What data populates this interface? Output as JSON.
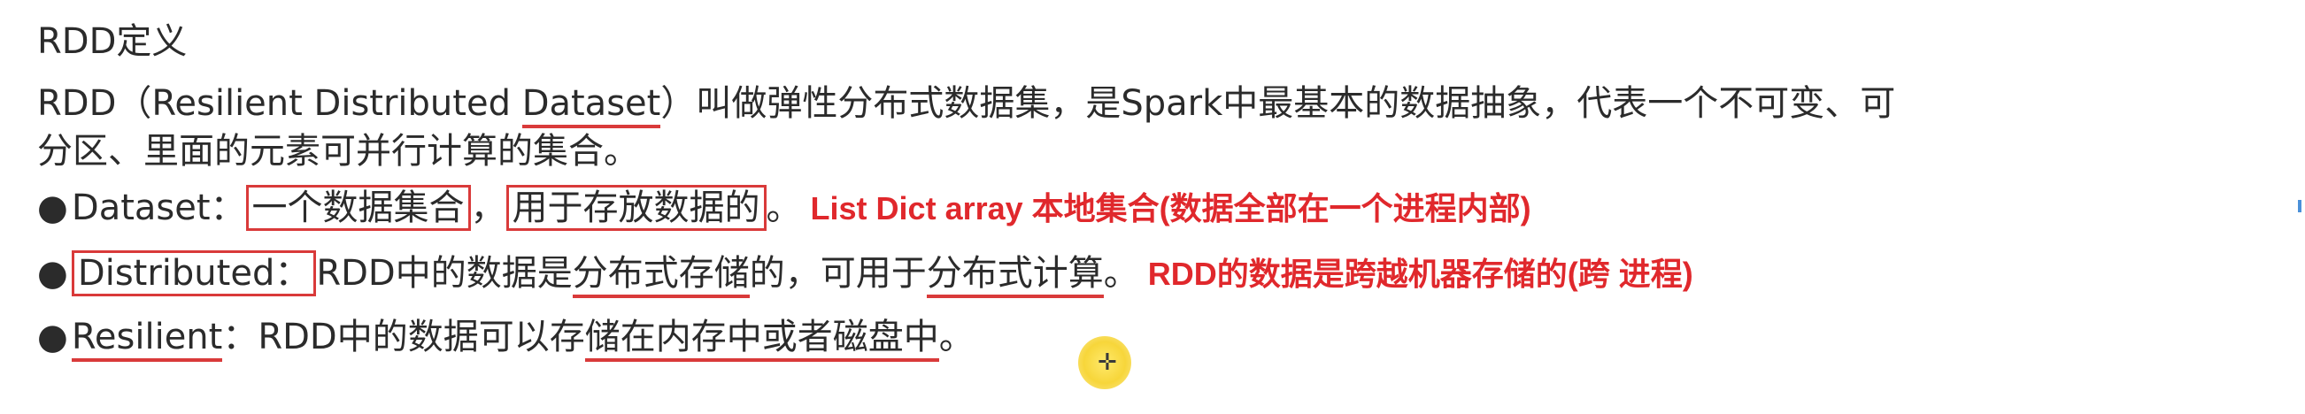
{
  "title": "RDD定义",
  "intro": {
    "line1_a": "RDD（Resilient Distributed ",
    "line1_underlined": "Dataset",
    "line1_b": "）叫做弹性分布式数据集，是Spark中最基本的数据抽象，代表一个不可变、可",
    "line2": "分区、里面的元素可并行计算的集合。"
  },
  "items": [
    {
      "bullet": "●",
      "term": "Dataset：",
      "box1": "一个数据集合",
      "sep": "，",
      "box2": "用于存放数据的",
      "end": "。",
      "note": "List Dict array 本地集合(数据全部在一个进程内部)"
    },
    {
      "bullet": "●",
      "term": "Distributed：",
      "a": "RDD中的数据是",
      "u1": "分布式存储",
      "b": "的，可用于",
      "u2": "分布式计算",
      "end": "。",
      "note": "RDD的数据是跨越机器存储的(跨 进程)"
    },
    {
      "bullet": "●",
      "term": "Resilient",
      "a": "：RDD中的数据可以存",
      "u1": "储在内存中或者磁盘中",
      "end": "。"
    }
  ],
  "colors": {
    "annotation_red": "#d93a3a",
    "text": "#2b2b2b",
    "cursor_highlight": "#f7d63a"
  }
}
